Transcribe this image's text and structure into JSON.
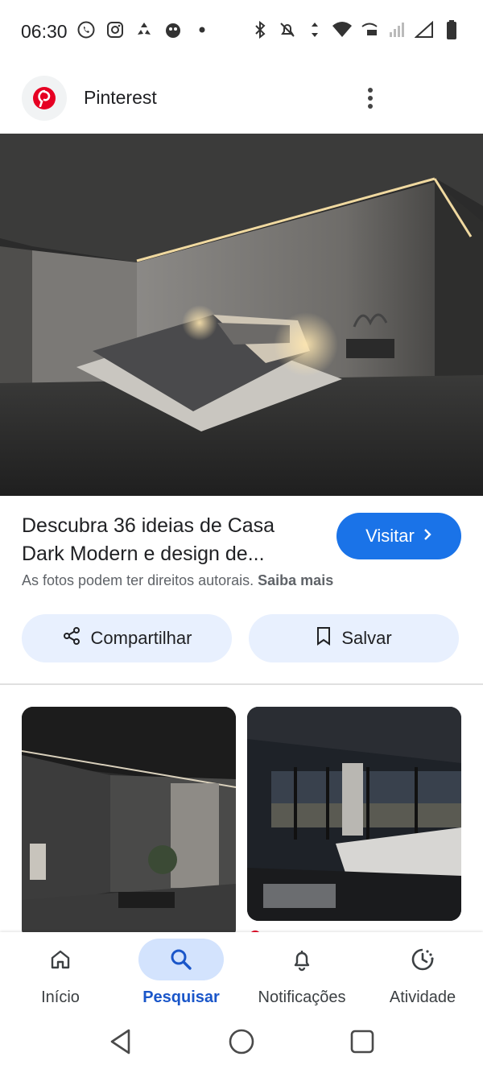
{
  "status_bar": {
    "time": "06:30",
    "left_icons": [
      "whatsapp-icon",
      "instagram-icon",
      "recycle-icon",
      "app-icon",
      "dot-icon"
    ],
    "right_icons": [
      "bluetooth-icon",
      "mute-icon",
      "data-arrows-icon",
      "wifi-icon",
      "wifi-calling-icon",
      "signal-icon",
      "signal-empty-icon",
      "battery-icon"
    ]
  },
  "header": {
    "site_name": "Pinterest",
    "logo_icon": "pinterest-logo-icon",
    "menu_icon": "more-vert-icon"
  },
  "result": {
    "title": "Descubra 36 ideias de Casa Dark Modern e design de...",
    "visit_label": "Visitar",
    "copyright_text": "As fotos podem ter direitos autorais.",
    "learn_more": "Saiba mais"
  },
  "actions": {
    "share_label": "Compartilhar",
    "save_label": "Salvar"
  },
  "bottom_nav": {
    "items": [
      {
        "label": "Início",
        "icon": "home-icon"
      },
      {
        "label": "Pesquisar",
        "icon": "search-icon",
        "active": true
      },
      {
        "label": "Notificações",
        "icon": "bell-icon"
      },
      {
        "label": "Atividade",
        "icon": "activity-icon"
      }
    ]
  },
  "colors": {
    "accent": "#1a73e8",
    "pinterest_red": "#e60023",
    "chip_bg": "#e8f0fe"
  }
}
